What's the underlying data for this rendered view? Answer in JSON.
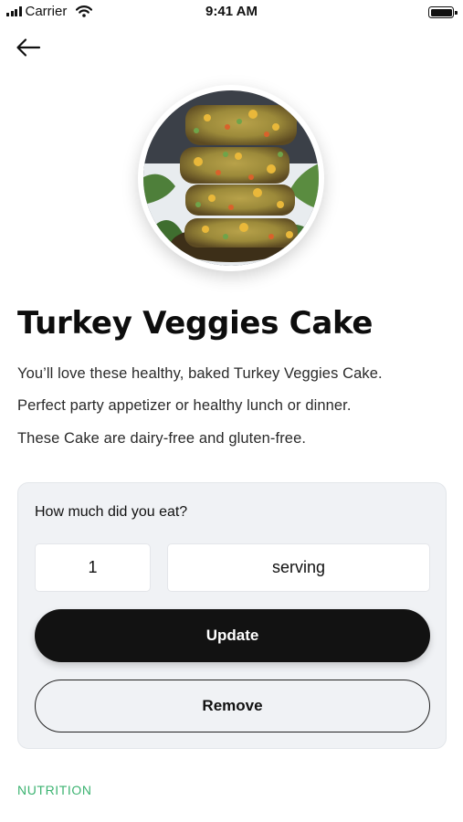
{
  "status_bar": {
    "carrier": "Carrier",
    "time": "9:41 AM"
  },
  "recipe": {
    "title": "Turkey Veggies Cake",
    "description": [
      "You’ll love these healthy, baked Turkey Veggies Cake.",
      "Perfect party appetizer or healthy lunch or dinner.",
      "These Cake are dairy-free and gluten-free."
    ]
  },
  "portion": {
    "question": "How much did you eat?",
    "quantity": "1",
    "unit": "serving",
    "update_label": "Update",
    "remove_label": "Remove"
  },
  "sections": {
    "nutrition_label": "NUTRITION"
  },
  "colors": {
    "accent_green": "#3cb371",
    "primary_button": "#121212",
    "card_bg": "#f0f2f5"
  },
  "icons": {
    "back": "arrow-left-icon",
    "signal": "signal-bars-icon",
    "wifi": "wifi-icon",
    "battery": "battery-icon"
  }
}
